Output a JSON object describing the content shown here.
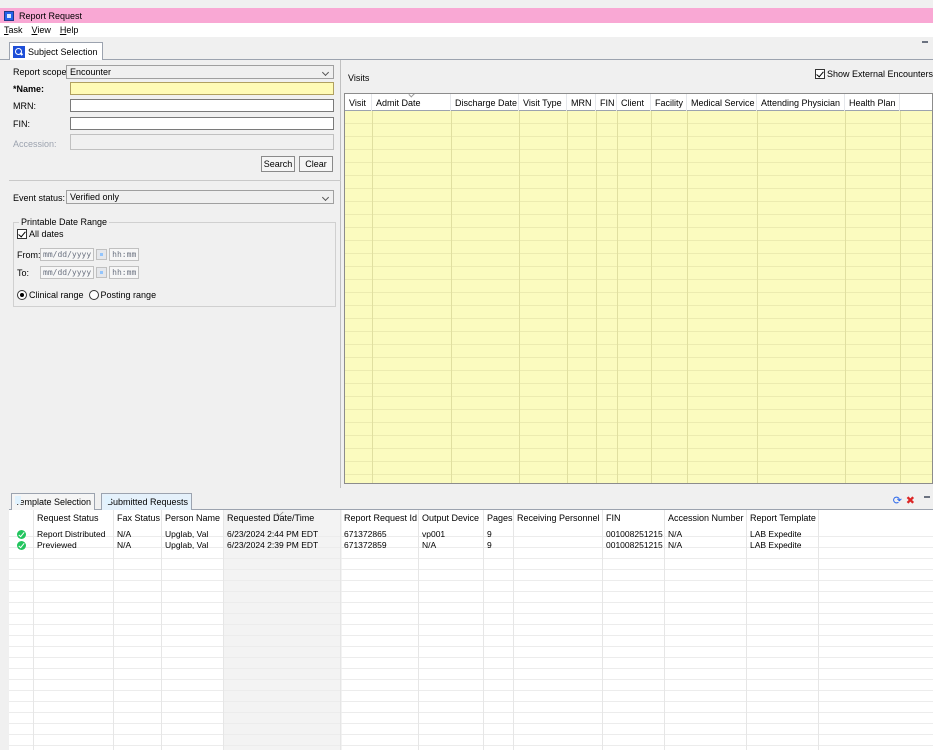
{
  "window": {
    "title": "Report Request"
  },
  "menu": [
    "Task",
    "View",
    "Help"
  ],
  "top_tab": {
    "label": "Subject Selection"
  },
  "subject": {
    "report_scope_label": "Report scope:",
    "report_scope_value": "Encounter",
    "name_label": "*Name:",
    "mrn_label": "MRN:",
    "fin_label": "FIN:",
    "accession_label": "Accession:",
    "search_button": "Search",
    "clear_button": "Clear",
    "event_status_label": "Event status:",
    "event_status_value": "Verified only",
    "date_range_title": "Printable Date Range",
    "all_dates_label": "All dates",
    "from_label": "From:",
    "to_label": "To:",
    "date_placeholder": "mm/dd/yyyy",
    "time_placeholder": "hh:mm",
    "clinical_range_label": "Clinical range",
    "posting_range_label": "Posting range"
  },
  "visits": {
    "title": "Visits",
    "show_external_label": "Show External Encounters",
    "columns": [
      "Visit",
      "Admit Date",
      "Discharge Date",
      "Visit Type",
      "MRN",
      "FIN",
      "Client",
      "Facility",
      "Medical Service",
      "Attending Physician",
      "Health Plan"
    ]
  },
  "bottom_tabs": [
    "Template Selection",
    "Submitted Requests"
  ],
  "requests": {
    "columns": [
      "Request Status",
      "Fax Status",
      "Person Name",
      "Requested Date/Time",
      "Report Request Id",
      "Output Device",
      "Pages",
      "Receiving Personnel",
      "FIN",
      "Accession Number",
      "Report Template"
    ],
    "rows": [
      [
        "Report Distributed",
        "N/A",
        "Upglab, Val",
        "6/23/2024 2:44 PM EDT",
        "671372865",
        "vp001",
        "9",
        "",
        "001008251215",
        "N/A",
        "LAB Expedite"
      ],
      [
        "Previewed",
        "N/A",
        "Upglab, Val",
        "6/23/2024 2:39 PM EDT",
        "671372859",
        "N/A",
        "9",
        "",
        "001008251215",
        "N/A",
        "LAB Expedite"
      ]
    ]
  }
}
